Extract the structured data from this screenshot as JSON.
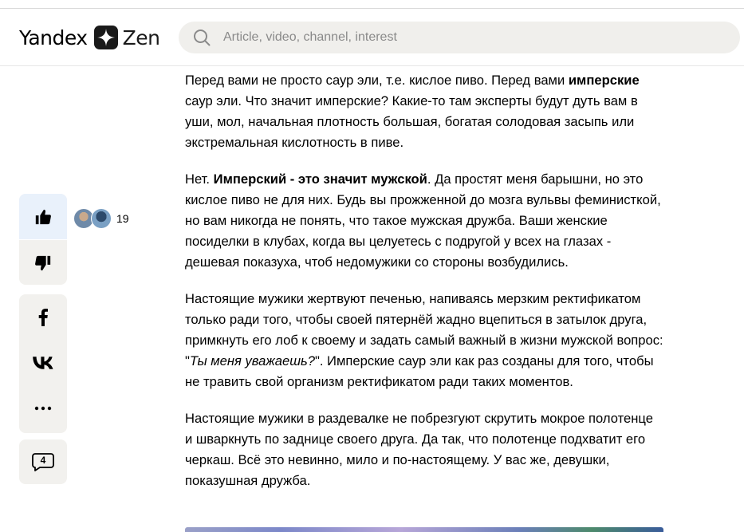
{
  "header": {
    "logo_brand": "Yandex",
    "logo_product": "Zen",
    "search_placeholder": "Article, video, channel, interest"
  },
  "reactions": {
    "like_count": "19"
  },
  "comments": {
    "count": "4"
  },
  "article": {
    "p1": {
      "t1": "Перед вами не просто саур эли, т.е. кислое пиво. Перед вами ",
      "b1": "имперские",
      "t2": " саур эли. Что значит имперские? Какие-то там эксперты будут дуть вам в уши, мол, начальная плотность большая, богатая солодовая засыпь или экстремальная кислотность в пиве."
    },
    "p2": {
      "t1": "Нет. ",
      "b1": "Имперский - это значит мужской",
      "t2": ". Да простят меня барышни, но это кислое пиво не для них. Будь вы прожженной до мозга вульвы феминисткой, но вам никогда не понять, что такое мужская дружба. Ваши женские посиделки в клубах, когда вы целуетесь с подругой у всех на глазах - дешевая показуха, чтоб недомужики со стороны возбудились."
    },
    "p3": {
      "t1": "Настоящие мужики жертвуют печенью, напиваясь мерзким ректификатом только ради того, чтобы своей пятернёй жадно вцепиться в затылок друга, примкнуть его лоб к своему и задать самый важный в жизни мужской вопрос: \"",
      "i1": "Ты меня уважаешь?",
      "t2": "\". Имперские саур эли как раз созданы для того, чтобы не травить свой организм ректификатом ради таких моментов."
    },
    "p4": "Настоящие мужики в раздевалке не побрезгуют скрутить мокрое полотенце и шваркнуть по заднице своего друга. Да так, что полотенце подхватит его черкаш. Всё это невинно, мило и по-настоящему. У вас же, девушки, показушная дружба."
  }
}
